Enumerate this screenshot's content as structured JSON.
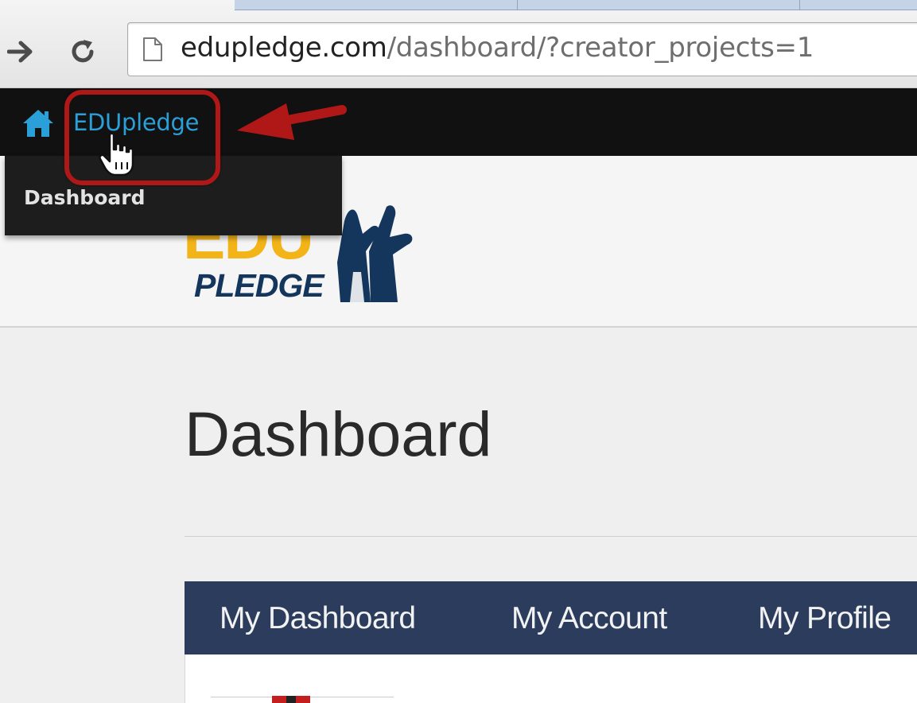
{
  "browser": {
    "url_host": "edupledge.com",
    "url_path": "/dashboard/?creator_projects=1"
  },
  "site": {
    "brand": "EDUpledge",
    "menu": {
      "items": [
        {
          "label": "Dashboard"
        }
      ]
    },
    "logo": {
      "top_text": "EDU",
      "bottom_text": "PLEDGE"
    }
  },
  "main": {
    "page_title": "Dashboard",
    "tabs": [
      {
        "label": "My Dashboard"
      },
      {
        "label": "My Account"
      },
      {
        "label": "My Profile"
      }
    ]
  },
  "colors": {
    "site_bar": "#111111",
    "brand_link": "#2a9fd8",
    "tabs_bar": "#2b3c5d",
    "annotation": "#b01818",
    "logo_gold": "#f3b418",
    "logo_navy": "#14365d"
  },
  "icons": {
    "forward": "arrow-right-icon",
    "reload": "reload-icon",
    "page": "page-icon",
    "home": "home-icon",
    "cursor": "hand-pointer-icon",
    "annotation": "arrow-left-icon"
  }
}
